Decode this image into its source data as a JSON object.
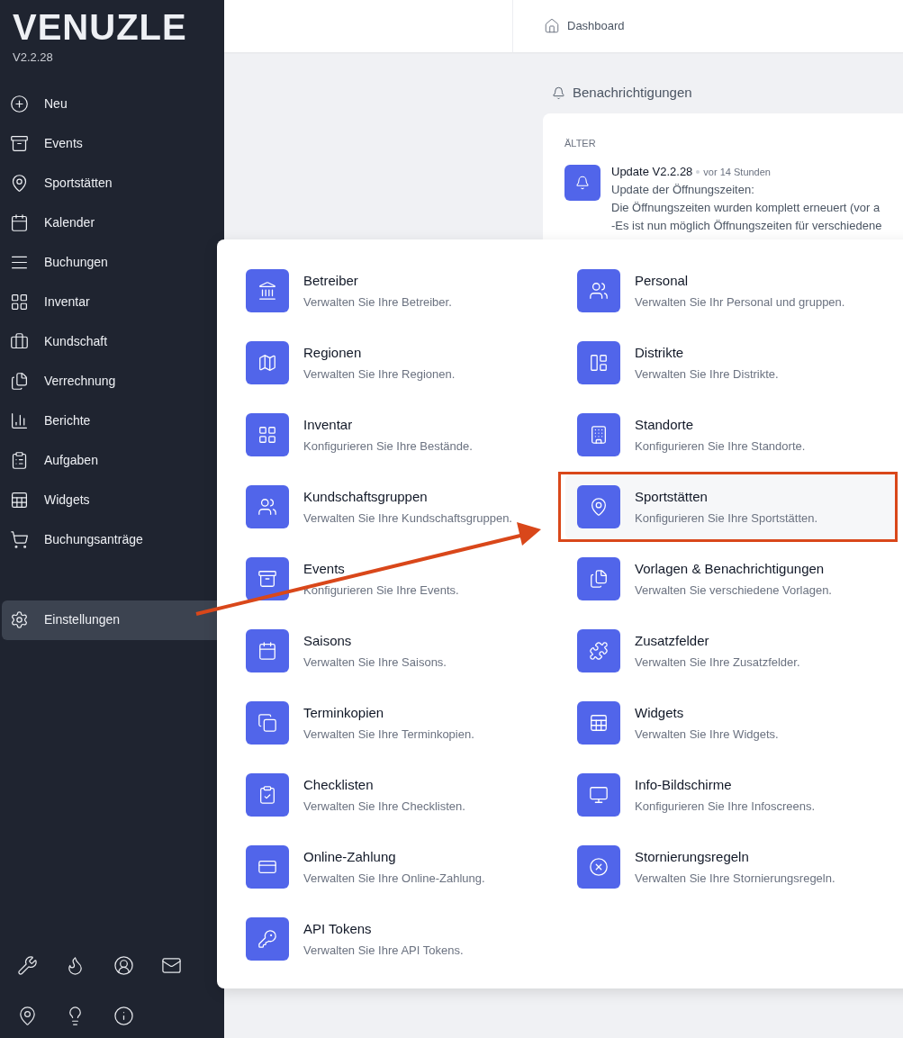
{
  "brand": {
    "logo": "VENUZLE",
    "version": "V2.2.28"
  },
  "sidebar": {
    "items": [
      {
        "label": "Neu",
        "selected": false,
        "kind": "nav"
      },
      {
        "label": "Events",
        "selected": false,
        "kind": "nav"
      },
      {
        "label": "Sportstätten",
        "selected": false,
        "kind": "nav"
      },
      {
        "label": "Kalender",
        "selected": false,
        "kind": "nav"
      },
      {
        "label": "Buchungen",
        "selected": false,
        "kind": "nav"
      },
      {
        "label": "Inventar",
        "selected": false,
        "kind": "nav"
      },
      {
        "label": "Kundschaft",
        "selected": false,
        "kind": "nav"
      },
      {
        "label": "Verrechnung",
        "selected": false,
        "kind": "nav"
      },
      {
        "label": "Berichte",
        "selected": false,
        "kind": "nav"
      },
      {
        "label": "Aufgaben",
        "selected": false,
        "kind": "nav"
      },
      {
        "label": "Widgets",
        "selected": false,
        "kind": "nav"
      },
      {
        "label": "Buchungsanträge",
        "selected": false,
        "kind": "nav"
      },
      {
        "label": "Einstellungen",
        "selected": true,
        "kind": "settings"
      }
    ]
  },
  "header": {
    "breadcrumb": "Dashboard"
  },
  "notifications": {
    "title": "Benachrichtigungen",
    "group": "ÄLTER",
    "items": [
      {
        "title": "Update V2.2.28",
        "time": "vor 14 Stunden",
        "lines": [
          "Update der Öffnungszeiten:",
          "Die Öffnungszeiten wurden komplett erneuert (vor a",
          "-Es ist nun möglich Öffnungszeiten für verschiedene"
        ]
      }
    ]
  },
  "settings_menu": {
    "items": [
      {
        "title": "Betreiber",
        "description": "Verwalten Sie Ihre Betreiber.",
        "selected": false
      },
      {
        "title": "Personal",
        "description": "Verwalten Sie Ihr Personal und gruppen.",
        "selected": false
      },
      {
        "title": "Regionen",
        "description": "Verwalten Sie Ihre Regionen.",
        "selected": false
      },
      {
        "title": "Distrikte",
        "description": "Verwalten Sie Ihre Distrikte.",
        "selected": false
      },
      {
        "title": "Inventar",
        "description": "Konfigurieren Sie Ihre Bestände.",
        "selected": false
      },
      {
        "title": "Standorte",
        "description": "Konfigurieren Sie Ihre Standorte.",
        "selected": false
      },
      {
        "title": "Kundschaftsgruppen",
        "description": "Verwalten Sie Ihre Kundschaftsgruppen.",
        "selected": false
      },
      {
        "title": "Sportstätten",
        "description": "Konfigurieren Sie Ihre Sportstätten.",
        "selected": true
      },
      {
        "title": "Events",
        "description": "Konfigurieren Sie Ihre Events.",
        "selected": false
      },
      {
        "title": "Vorlagen & Benachrichtigungen",
        "description": "Verwalten Sie verschiedene Vorlagen.",
        "selected": false
      },
      {
        "title": "Saisons",
        "description": "Verwalten Sie Ihre Saisons.",
        "selected": false
      },
      {
        "title": "Zusatzfelder",
        "description": "Verwalten Sie Ihre Zusatzfelder.",
        "selected": false
      },
      {
        "title": "Terminkopien",
        "description": "Verwalten Sie Ihre Terminkopien.",
        "selected": false
      },
      {
        "title": "Widgets",
        "description": "Verwalten Sie Ihre Widgets.",
        "selected": false
      },
      {
        "title": "Checklisten",
        "description": "Verwalten Sie Ihre Checklisten.",
        "selected": false
      },
      {
        "title": "Info-Bildschirme",
        "description": "Konfigurieren Sie Ihre Infoscreens.",
        "selected": false
      },
      {
        "title": "Online-Zahlung",
        "description": "Verwalten Sie Ihre Online-Zahlung.",
        "selected": false
      },
      {
        "title": "Stornierungsregeln",
        "description": "Verwalten Sie Ihre Stornierungsregeln.",
        "selected": false
      },
      {
        "title": "API Tokens",
        "description": "Verwalten Sie Ihre API Tokens.",
        "selected": false
      }
    ]
  }
}
